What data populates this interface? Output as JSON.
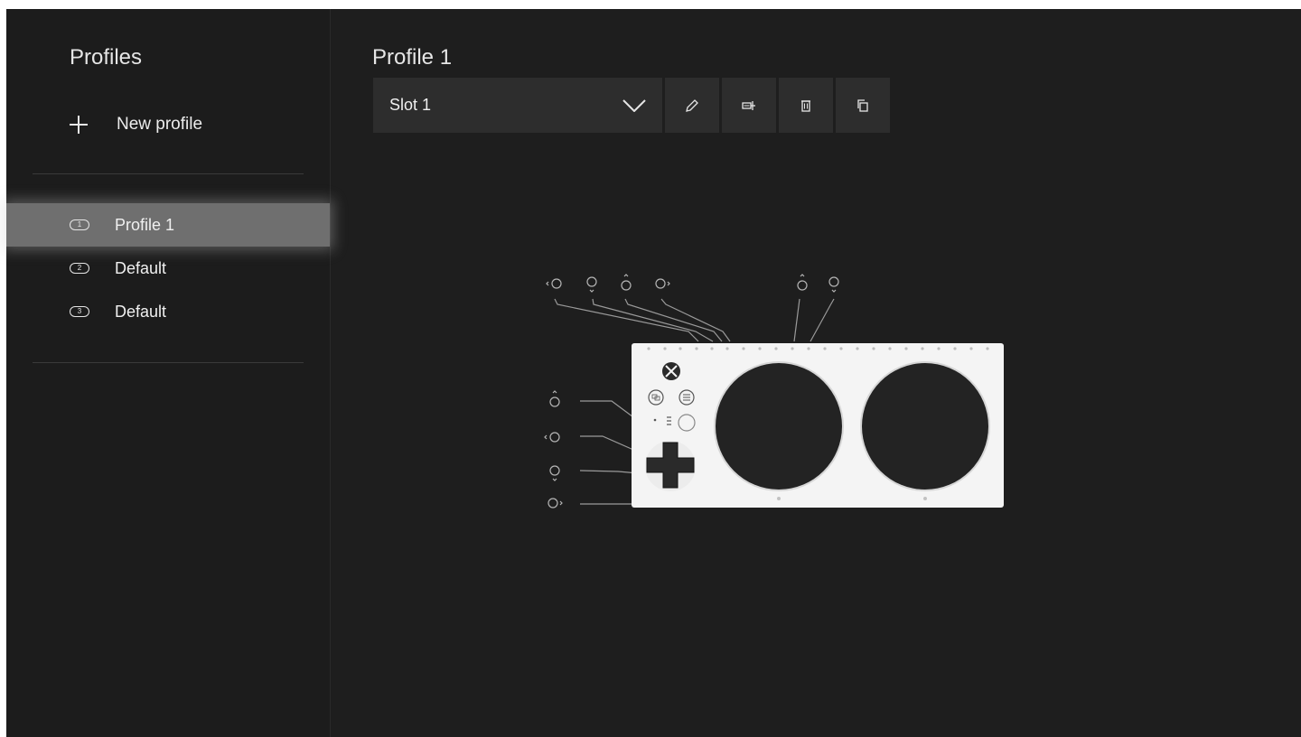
{
  "sidebar": {
    "title": "Profiles",
    "new_profile_label": "New profile",
    "profiles": [
      {
        "slot": "1",
        "label": "Profile 1",
        "selected": true
      },
      {
        "slot": "2",
        "label": "Default",
        "selected": false
      },
      {
        "slot": "3",
        "label": "Default",
        "selected": false
      }
    ]
  },
  "main": {
    "title": "Profile 1",
    "slot_dropdown": {
      "selected": "Slot 1"
    },
    "toolbar_icons": [
      "pencil-icon",
      "controller-test-icon",
      "trash-icon",
      "copy-icon"
    ]
  },
  "controller": {
    "name": "adaptive-controller",
    "colors": {
      "body": "#f4f4f4",
      "pads": "#222222",
      "background": "#1e1e1e"
    }
  }
}
